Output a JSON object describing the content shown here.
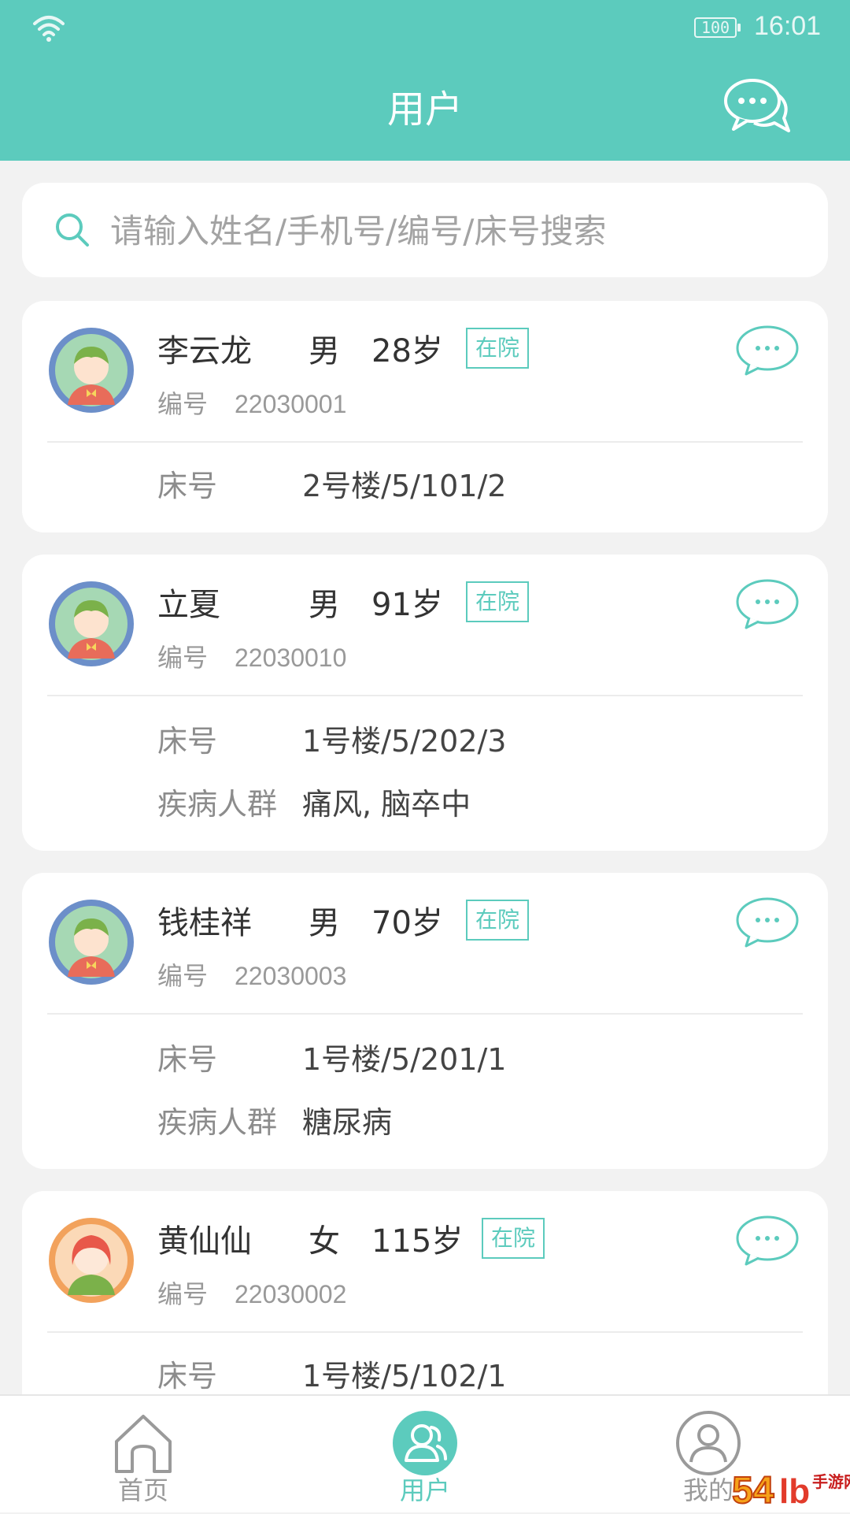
{
  "status_bar": {
    "battery": "100",
    "time": "16:01"
  },
  "header": {
    "title": "用户"
  },
  "search": {
    "placeholder": "请输入姓名/手机号/编号/床号搜索"
  },
  "users": [
    {
      "name": "李云龙",
      "gender": "男",
      "age": "28岁",
      "status": "在院",
      "code_label": "编号",
      "code": "22030001",
      "bed_label": "床号",
      "bed": "2号楼/5/101/2",
      "avatar": "male-avatar"
    },
    {
      "name": "立夏",
      "gender": "男",
      "age": "91岁",
      "status": "在院",
      "code_label": "编号",
      "code": "22030010",
      "bed_label": "床号",
      "bed": "1号楼/5/202/3",
      "disease_label": "疾病人群",
      "disease": "痛风, 脑卒中",
      "avatar": "male-avatar"
    },
    {
      "name": "钱桂祥",
      "gender": "男",
      "age": "70岁",
      "status": "在院",
      "code_label": "编号",
      "code": "22030003",
      "bed_label": "床号",
      "bed": "1号楼/5/201/1",
      "disease_label": "疾病人群",
      "disease": "糖尿病",
      "avatar": "male-avatar"
    },
    {
      "name": "黄仙仙",
      "gender": "女",
      "age": "115岁",
      "status": "在院",
      "code_label": "编号",
      "code": "22030002",
      "bed_label": "床号",
      "bed": "1号楼/5/102/1",
      "avatar": "female-avatar"
    }
  ],
  "bottom_nav": [
    {
      "label": "首页",
      "icon": "home-icon",
      "active": false
    },
    {
      "label": "用户",
      "icon": "users-icon",
      "active": true
    },
    {
      "label": "我的",
      "icon": "profile-icon",
      "active": false
    }
  ],
  "watermark": {
    "text": "手游网"
  },
  "colors": {
    "accent": "#5ccbbd",
    "inactive": "#9a9a9a"
  }
}
